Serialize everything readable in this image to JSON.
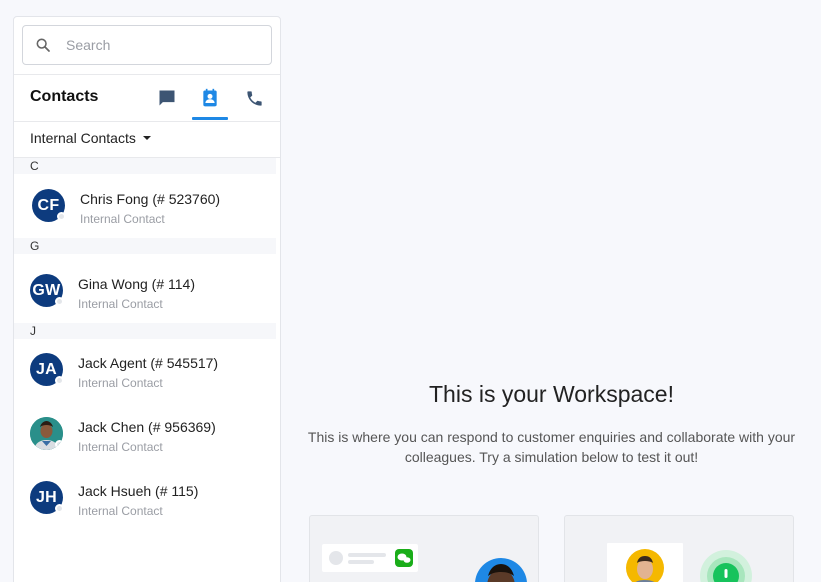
{
  "search": {
    "placeholder": "Search"
  },
  "header": {
    "title": "Contacts",
    "tabs": [
      {
        "icon": "chat-icon"
      },
      {
        "icon": "contacts-book-icon",
        "active": true
      },
      {
        "icon": "phone-icon"
      }
    ]
  },
  "filter": {
    "label": "Internal Contacts"
  },
  "groups": [
    {
      "letter": "C",
      "contacts": [
        {
          "initials": "CF",
          "name": "Chris Fong (# 523760)",
          "type": "Internal Contact"
        }
      ]
    },
    {
      "letter": "G",
      "contacts": [
        {
          "initials": "GW",
          "name": "Gina Wong (# 114)",
          "type": "Internal Contact"
        }
      ]
    },
    {
      "letter": "J",
      "contacts": [
        {
          "initials": "JA",
          "name": "Jack Agent (# 545517)",
          "type": "Internal Contact"
        },
        {
          "initials": "",
          "name": "Jack Chen (# 956369)",
          "type": "Internal Contact"
        },
        {
          "initials": "JH",
          "name": "Jack Hsueh (# 115)",
          "type": "Internal Contact"
        }
      ]
    }
  ],
  "workspace": {
    "title": "This is your Workspace!",
    "description": "This is where you can respond to customer enquiries and collaborate with your colleagues. Try a simulation below to test it out!"
  },
  "colors": {
    "accent": "#1e88e5",
    "avatar": "#0d3b7e",
    "icon": "#3d5573"
  }
}
